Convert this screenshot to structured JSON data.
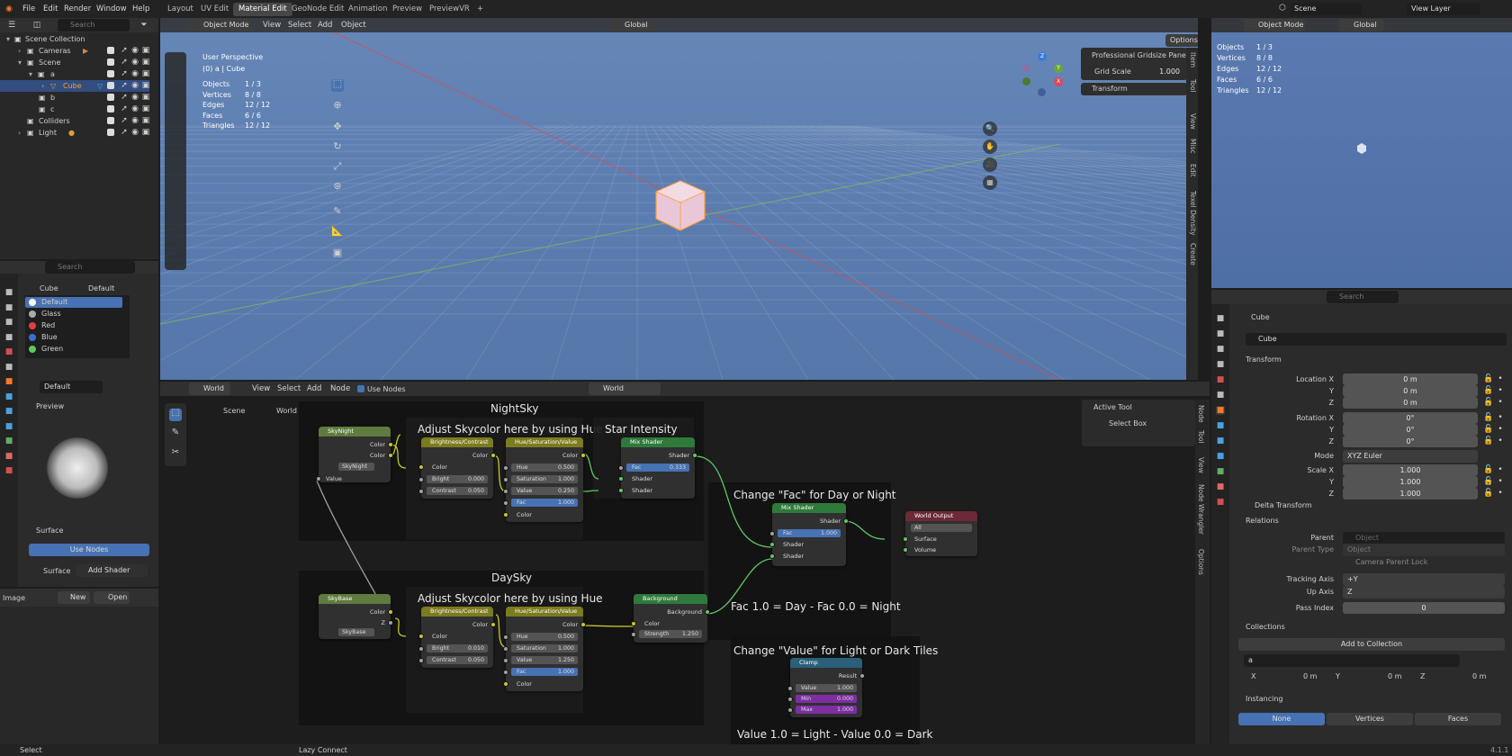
{
  "topbar": {
    "menus": [
      "File",
      "Edit",
      "Render",
      "Window",
      "Help"
    ],
    "workspaces": [
      "Layout",
      "UV Edit",
      "Material Edit",
      "GeoNode Edit",
      "Animation",
      "Preview",
      "PreviewVR"
    ],
    "active_workspace": "Material Edit",
    "add_workspace": "+",
    "scene": "Scene",
    "view_layer": "View Layer"
  },
  "outliner": {
    "search_placeholder": "Search",
    "items": [
      "Scene Collection",
      "Cameras",
      "Scene",
      "a",
      "Cube",
      "b",
      "c",
      "Colliders",
      "Light"
    ]
  },
  "viewport": {
    "mode": "Object Mode",
    "menus": [
      "View",
      "Select",
      "Add",
      "Object"
    ],
    "orientation": "Global",
    "options": "Options",
    "title": "User Perspective",
    "subtitle": "(0) a | Cube",
    "stats": [
      {
        "k": "Objects",
        "v": "1 / 3"
      },
      {
        "k": "Vertices",
        "v": "8 / 8"
      },
      {
        "k": "Edges",
        "v": "12 / 12"
      },
      {
        "k": "Faces",
        "v": "6 / 6"
      },
      {
        "k": "Triangles",
        "v": "12 / 12"
      }
    ],
    "gridsize_panel": "Professional Gridsize Panel",
    "grid_scale_label": "Grid Scale",
    "grid_scale_value": "1.000",
    "transform_panel": "Transform",
    "side_tabs": [
      "Item",
      "Tool",
      "View",
      "Misc",
      "Edit",
      "Texel Density",
      "Create"
    ]
  },
  "mini_viewport": {
    "mode": "Object Mode",
    "orientation": "Global",
    "stats": [
      {
        "k": "Objects",
        "v": "1 / 3"
      },
      {
        "k": "Vertices",
        "v": "8 / 8"
      },
      {
        "k": "Edges",
        "v": "12 / 12"
      },
      {
        "k": "Faces",
        "v": "6 / 6"
      },
      {
        "k": "Triangles",
        "v": "12 / 12"
      }
    ]
  },
  "material_panel": {
    "search_placeholder": "Search",
    "breadcrumb_object": "Cube",
    "breadcrumb_material": "Default",
    "slots": [
      {
        "name": "Default",
        "color": "#ffffff"
      },
      {
        "name": "Glass",
        "color": "#aaaaaa"
      },
      {
        "name": "Red",
        "color": "#e04040"
      },
      {
        "name": "Blue",
        "color": "#3b6fd8"
      },
      {
        "name": "Green",
        "color": "#5fc85f"
      }
    ],
    "material_name": "Default",
    "preview_label": "Preview",
    "surface_label": "Surface",
    "use_nodes": "Use Nodes",
    "surface_field_label": "Surface",
    "surface_value": "Add Shader"
  },
  "image_editor": {
    "label": "Image",
    "new": "New",
    "open": "Open"
  },
  "node_editor": {
    "world_type": "World",
    "menus": [
      "View",
      "Select",
      "Add",
      "Node"
    ],
    "use_nodes": "Use Nodes",
    "world_name": "World",
    "breadcrumb": [
      "Scene",
      "World"
    ],
    "frames": {
      "nightsky": "NightSky",
      "daysky": "DaySky",
      "adjust1": "Adjust Skycolor here by using Hue",
      "adjust2": "Adjust Skycolor here by using Hue",
      "intensity": "Star Intensity",
      "fac": "Change \"Fac\" for Day or Night",
      "fac_note": "Fac 1.0 = Day - Fac 0.0 = Night",
      "value": "Change \"Value\" for Light or Dark Tiles",
      "value_note": "Value 1.0 = Light - Value 0.0 = Dark"
    },
    "nodes": {
      "skynight": {
        "title": "SkyNight",
        "out1": "Color",
        "out2": "Color",
        "img": "SkyNight",
        "in": "Value"
      },
      "skybase": {
        "title": "SkyBase",
        "out1": "Color",
        "out2": "Z",
        "img": "SkyBase"
      },
      "bc1": {
        "title": "Brightness/Contrast",
        "out": "Color",
        "in": "Color",
        "bright_label": "Bright",
        "bright": "0.000",
        "contrast_label": "Contrast",
        "contrast": "0.050"
      },
      "bc2": {
        "title": "Brightness/Contrast",
        "out": "Color",
        "in": "Color",
        "bright_label": "Bright",
        "bright": "0.010",
        "contrast_label": "Contrast",
        "contrast": "0.050"
      },
      "hsv1": {
        "title": "Hue/Saturation/Value",
        "out": "Color",
        "hue_label": "Hue",
        "hue": "0.500",
        "sat_label": "Saturation",
        "sat": "1.000",
        "val_label": "Value",
        "val": "0.250",
        "fac_label": "Fac",
        "fac": "1.000",
        "in": "Color"
      },
      "hsv2": {
        "title": "Hue/Saturation/Value",
        "out": "Color",
        "hue_label": "Hue",
        "hue": "0.500",
        "sat_label": "Saturation",
        "sat": "1.000",
        "val_label": "Value",
        "val": "1.250",
        "fac_label": "Fac",
        "fac": "1.000",
        "in": "Color"
      },
      "mix1": {
        "title": "Mix Shader",
        "out": "Shader",
        "fac_label": "Fac",
        "fac": "0.333",
        "in1": "Shader",
        "in2": "Shader"
      },
      "mix2": {
        "title": "Mix Shader",
        "out": "Shader",
        "fac_label": "Fac",
        "fac": "1.000",
        "in1": "Shader",
        "in2": "Shader"
      },
      "world_out": {
        "title": "World Output",
        "target": "All",
        "in1": "Surface",
        "in2": "Volume"
      },
      "background": {
        "title": "Background",
        "out": "Background",
        "in": "Color",
        "strength_label": "Strength",
        "strength": "1.250"
      },
      "clamp": {
        "title": "Clamp",
        "out": "Result",
        "value_label": "Value",
        "value": "1.000",
        "min_label": "Min",
        "min": "0.000",
        "max_label": "Max",
        "max": "1.000"
      }
    },
    "active_tool_panel": "Active Tool",
    "select_box": "Select Box",
    "side_tabs": [
      "Node",
      "Tool",
      "View",
      "Node Wrangler",
      "Options"
    ]
  },
  "properties": {
    "search_placeholder": "Search",
    "object_name": "Cube",
    "object_field": "Cube",
    "transform": "Transform",
    "location_label": "Location X",
    "location": [
      "0 m",
      "0 m",
      "0 m"
    ],
    "rotation_label": "Rotation X",
    "rotation": [
      "0°",
      "0°",
      "0°"
    ],
    "axis_y": "Y",
    "axis_z": "Z",
    "mode_label": "Mode",
    "mode_value": "XYZ Euler",
    "scale_label": "Scale X",
    "scale": [
      "1.000",
      "1.000",
      "1.000"
    ],
    "delta": "Delta Transform",
    "relations": "Relations",
    "parent_label": "Parent",
    "parent_placeholder": "Object",
    "parent_type_label": "Parent Type",
    "parent_type_value": "Object",
    "camera_parent_lock": "Camera Parent Lock",
    "tracking_axis_label": "Tracking Axis",
    "tracking_axis_value": "+Y",
    "up_axis_label": "Up Axis",
    "up_axis_value": "Z",
    "pass_index_label": "Pass Index",
    "pass_index_value": "0",
    "collections": "Collections",
    "add_to_collection": "Add to Collection",
    "collection_name": "a",
    "offset": [
      {
        "k": "X",
        "v": "0 m"
      },
      {
        "k": "Y",
        "v": "0 m"
      },
      {
        "k": "Z",
        "v": "0 m"
      }
    ],
    "instancing": "Instancing",
    "instancing_opts": [
      "None",
      "Vertices",
      "Faces"
    ]
  },
  "statusbar": {
    "left": "Select",
    "middle": "Lazy Connect",
    "version": "4.1.1"
  }
}
